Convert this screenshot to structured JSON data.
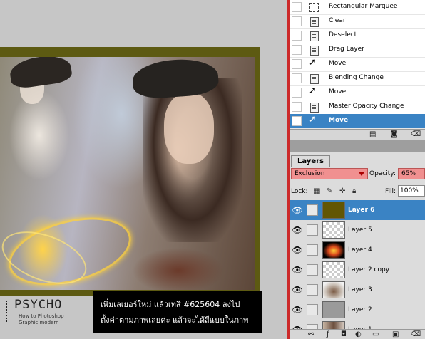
{
  "canvas": {
    "logo_main": "PSYCHO",
    "logo_sub1": "How to Photoshop",
    "logo_sub2": "Graphic modern",
    "caption_line1": "เพิ่มเลเยอร์ใหม่ แล้วเทสี #625604 ลงไป",
    "caption_line2": "ตั้งค่าตามภาพเลยค่ะ แล้วจะได้สีแบบในภาพ",
    "fill_color": "#625604"
  },
  "history": {
    "items": [
      {
        "label": "Rectangular Marquee",
        "icon": "rect-marquee-icon"
      },
      {
        "label": "Clear",
        "icon": "history-state-icon"
      },
      {
        "label": "Deselect",
        "icon": "history-state-icon"
      },
      {
        "label": "Drag Layer",
        "icon": "history-state-icon"
      },
      {
        "label": "Move",
        "icon": "move-tool-icon"
      },
      {
        "label": "Blending Change",
        "icon": "history-state-icon"
      },
      {
        "label": "Move",
        "icon": "move-tool-icon"
      },
      {
        "label": "Master Opacity Change",
        "icon": "history-state-icon"
      },
      {
        "label": "Move",
        "icon": "move-tool-icon",
        "active": true
      }
    ]
  },
  "layers": {
    "tab_label": "Layers",
    "blend_mode": "Exclusion",
    "opacity_label": "Opacity:",
    "opacity_value": "65%",
    "lock_label": "Lock:",
    "fill_label": "Fill:",
    "fill_value": "100%",
    "items": [
      {
        "name": "Layer 6",
        "thumb": "solid",
        "active": true
      },
      {
        "name": "Layer 5",
        "thumb": "transparent"
      },
      {
        "name": "Layer 4",
        "thumb": "fire"
      },
      {
        "name": "Layer 2 copy",
        "thumb": "transparent"
      },
      {
        "name": "Layer 3",
        "thumb": "photo"
      },
      {
        "name": "Layer 2",
        "thumb": "gray"
      },
      {
        "name": "Layer 1",
        "thumb": "photo"
      }
    ]
  },
  "colors": {
    "selection": "#3a83c4",
    "highlight_field": "#f09090",
    "layer6_fill": "#625604"
  }
}
